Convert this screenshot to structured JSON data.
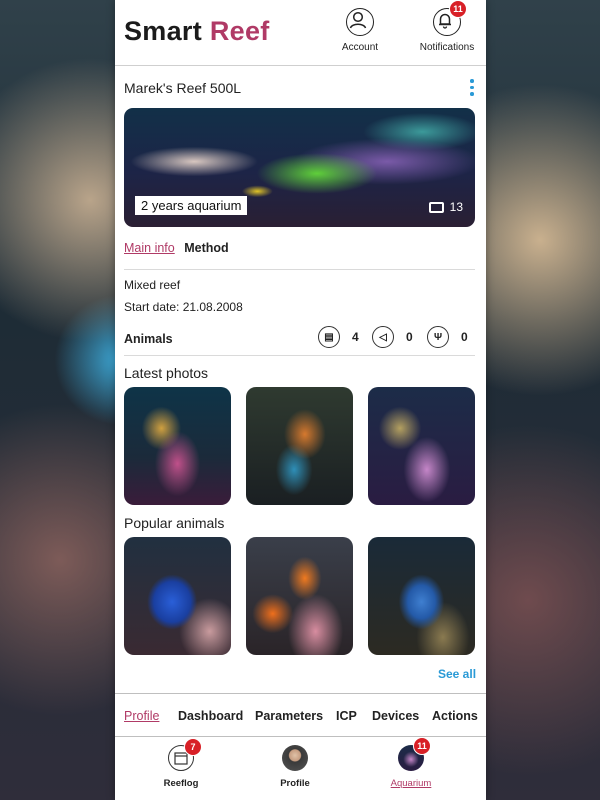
{
  "app": {
    "brand_main": "Smart",
    "brand_accent": "Reef"
  },
  "header": {
    "account_label": "Account",
    "notifications_label": "Notifications",
    "notifications_badge": "11"
  },
  "tank": {
    "name": "Marek's Reef 500L",
    "hero_caption": "2 years aquarium",
    "photo_count": "13",
    "tabs": [
      "Main info",
      "Method"
    ],
    "type": "Mixed reef",
    "start_date": "Start date: 21.08.2008"
  },
  "animals": {
    "label": "Animals",
    "stats": [
      {
        "icon": "coral-icon",
        "value": "4"
      },
      {
        "icon": "fish-icon",
        "value": "0"
      },
      {
        "icon": "plant-icon",
        "value": "0"
      }
    ]
  },
  "sections": {
    "latest_photos": "Latest photos",
    "popular_animals": "Popular animals",
    "see_all": "See all"
  },
  "bottom_tabs": [
    "Profile",
    "Dashboard",
    "Parameters",
    "ICP",
    "Devices",
    "Actions"
  ],
  "navbar": {
    "items": [
      {
        "label": "Reeflog",
        "badge": "7"
      },
      {
        "label": "Profile",
        "badge": ""
      },
      {
        "label": "Aquarium",
        "badge": "11"
      }
    ]
  },
  "colors": {
    "accent": "#b03a66",
    "link": "#2a9ad6",
    "badge": "#d82027"
  }
}
